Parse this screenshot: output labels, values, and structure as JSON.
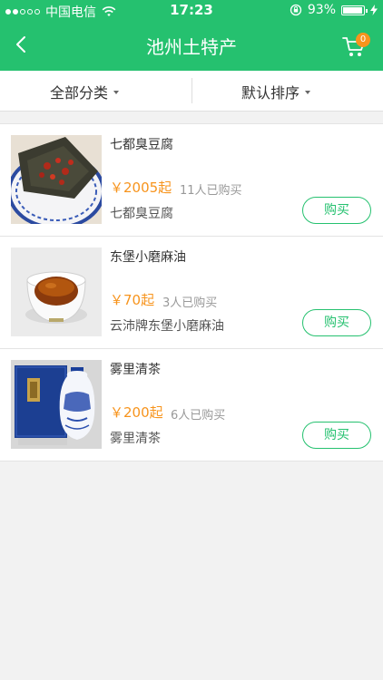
{
  "status_bar": {
    "carrier": "中国电信",
    "time": "17:23",
    "battery": "93%"
  },
  "nav": {
    "title": "池州土特产",
    "cart_count": "0"
  },
  "filter": {
    "category_label": "全部分类",
    "sort_label": "默认排序"
  },
  "products": [
    {
      "name": "七都臭豆腐",
      "price": "￥2005起",
      "sold": "11人已购买",
      "sub": "七都臭豆腐",
      "buy_label": "购买"
    },
    {
      "name": "东堡小磨麻油",
      "price": "￥70起",
      "sold": "3人已购买",
      "sub": "云沛牌东堡小磨麻油",
      "buy_label": "购买"
    },
    {
      "name": "雾里清茶",
      "price": "￥200起",
      "sold": "6人已购买",
      "sub": "雾里清茶",
      "buy_label": "购买"
    }
  ],
  "colors": {
    "accent": "#25c16f",
    "price": "#f7941d",
    "badge": "#f7941d"
  }
}
